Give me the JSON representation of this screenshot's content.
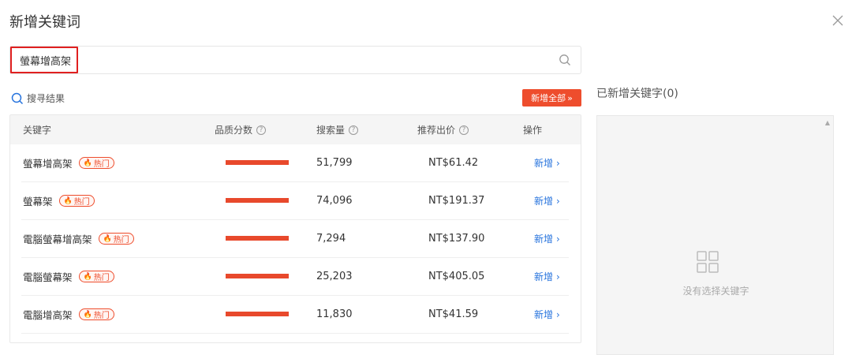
{
  "dialog": {
    "title": "新增关键词",
    "close_icon": "close-icon"
  },
  "search": {
    "value": "螢幕增高架",
    "icon": "search-icon"
  },
  "results": {
    "label": "搜寻结果",
    "add_all_label": "新增全部"
  },
  "table": {
    "headers": {
      "keyword": "关键字",
      "quality": "品质分数",
      "volume": "搜索量",
      "bid": "推荐出价",
      "action": "操作"
    },
    "hot_label": "热门",
    "action_label": "新增",
    "rows": [
      {
        "keyword": "螢幕增高架",
        "volume": "51,799",
        "bid": "NT$61.42"
      },
      {
        "keyword": "螢幕架",
        "volume": "74,096",
        "bid": "NT$191.37"
      },
      {
        "keyword": "電腦螢幕增高架",
        "volume": "7,294",
        "bid": "NT$137.90"
      },
      {
        "keyword": "電腦螢幕架",
        "volume": "25,203",
        "bid": "NT$405.05"
      },
      {
        "keyword": "電腦增高架",
        "volume": "11,830",
        "bid": "NT$41.59"
      }
    ]
  },
  "selected": {
    "title": "已新增关键字(0)",
    "empty_text": "没有选择关键字"
  },
  "colors": {
    "accent": "#ee4d2d",
    "link": "#2673dd",
    "highlight": "#e02020"
  }
}
